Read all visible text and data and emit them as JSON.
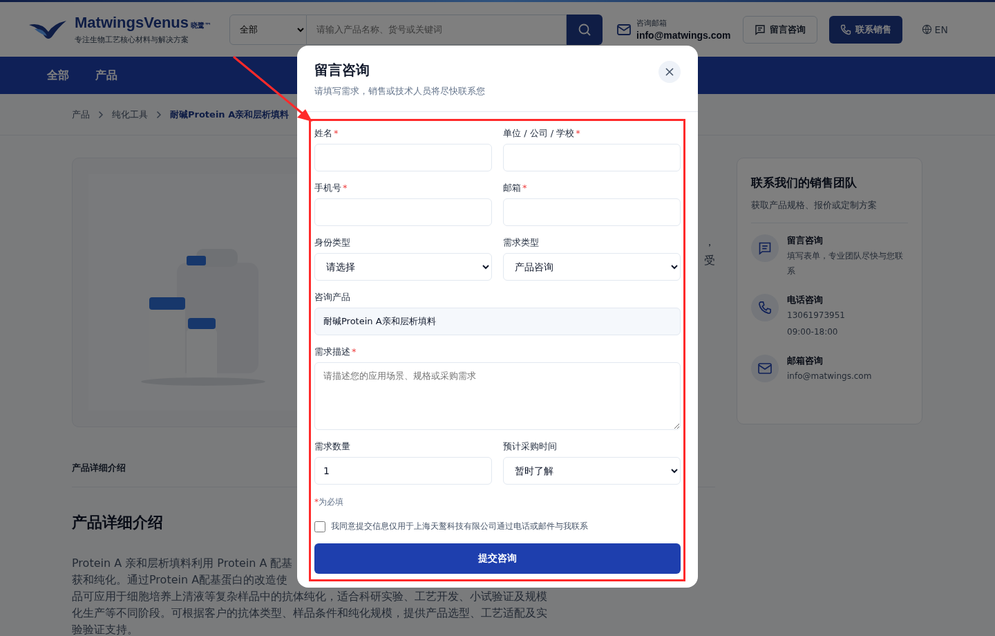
{
  "header": {
    "brand": "MatwingsVenus",
    "brand_mark": "晓鹭™",
    "tagline": "专注生物工艺核心材料与解决方案",
    "search": {
      "category": "全部",
      "placeholder": "请输入产品名称、货号或关键词"
    },
    "contact": {
      "label": "咨询邮箱",
      "email": "info@matwings.com"
    },
    "buttons": [
      {
        "label": "留言咨询",
        "kind": "outline"
      },
      {
        "label": "联系销售",
        "kind": "primary"
      }
    ],
    "language": "EN"
  },
  "nav": [
    {
      "label": "全部"
    },
    {
      "label": "产品"
    }
  ],
  "breadcrumb": [
    {
      "label": "产品",
      "selected": false
    },
    {
      "label": "纯化工具",
      "selected": false
    },
    {
      "label": "耐碱Protein A亲和层析填料",
      "selected": true
    }
  ],
  "product_text_fragments": [
    "，",
    "受"
  ],
  "sales_card": {
    "title": "联系我们的销售团队",
    "subtitle": "获取产品规格、报价或定制方案",
    "items": [
      {
        "kind": "message",
        "title": "留言咨询",
        "lines": [
          "填写表单，专业团队尽快与您联系"
        ]
      },
      {
        "kind": "phone",
        "title": "电话咨询",
        "lines": [
          "13061973951",
          "09:00-18:00"
        ]
      },
      {
        "kind": "mail",
        "title": "邮箱咨询",
        "lines": [
          "info@matwings.com"
        ]
      }
    ]
  },
  "detail_tab": "产品详细介绍",
  "detail_heading": "产品详细介绍",
  "detail_lines": [
    "Protein A 亲和层析填料利用 Protein A 配基",
    "获和纯化。通过Protein A配基蛋白的改造使",
    "品可应用于细胞培养上清液等复杂样品中的抗体纯化，适合科研实验、工艺开发、小试验证及规模",
    "化生产等不同阶段。可根据客户的抗体类型、样品条件和纯化规模，提供产品选型、工艺适配及实",
    "验验证支持。"
  ],
  "modal": {
    "title": "留言咨询",
    "subtitle": "请填写需求，销售或技术人员将尽快联系您",
    "rows": [
      [
        {
          "kind": "text",
          "label": "姓名",
          "required": true
        },
        {
          "kind": "text",
          "label": "单位 / 公司 / 学校",
          "required": true
        }
      ],
      [
        {
          "kind": "text",
          "label": "手机号",
          "required": true
        },
        {
          "kind": "text",
          "label": "邮箱",
          "required": true
        }
      ],
      [
        {
          "kind": "select",
          "label": "身份类型",
          "required": false,
          "value": "请选择"
        },
        {
          "kind": "select",
          "label": "需求类型",
          "required": false,
          "value": "产品咨询"
        }
      ],
      [
        {
          "kind": "text",
          "label": "咨询产品",
          "required": false,
          "value": "耐碱Protein A亲和层析填料",
          "readonly": true
        }
      ],
      [
        {
          "kind": "textarea",
          "label": "需求描述",
          "required": true,
          "placeholder": "请描述您的应用场景、规格或采购需求"
        }
      ],
      [
        {
          "kind": "text",
          "label": "需求数量",
          "required": false,
          "value": "1"
        },
        {
          "kind": "select",
          "label": "预计采购时间",
          "required": false,
          "value": "暂时了解"
        }
      ]
    ],
    "required_mark": "*",
    "required_note": "为必填",
    "consent": {
      "label": "我同意提交信息仅用于上海天鹜科技有限公司通过电话或邮件与我联系",
      "checked": false
    },
    "submit": "提交咨询"
  },
  "annotation": {
    "highlight": true
  }
}
